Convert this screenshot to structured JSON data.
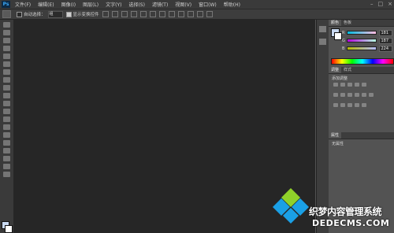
{
  "app": {
    "logo_text": "Ps"
  },
  "menu": {
    "items": [
      "文件(F)",
      "编辑(E)",
      "图像(I)",
      "图层(L)",
      "文字(Y)",
      "选择(S)",
      "滤镜(T)",
      "视图(V)",
      "窗口(W)",
      "帮助(H)"
    ]
  },
  "window_controls": {
    "minimize": "–",
    "maximize": "□",
    "close": "×"
  },
  "options_bar": {
    "auto_select_label": "自动选择：",
    "auto_select_value": "组",
    "show_transform_label": "显示变换控件"
  },
  "color_panel": {
    "tabs": [
      "颜色",
      "色板"
    ],
    "channels": [
      {
        "label": "R",
        "value": "181"
      },
      {
        "label": "G",
        "value": "187"
      },
      {
        "label": "B",
        "value": "224"
      }
    ],
    "foreground_color": "#c8d8f0",
    "background_color": "#ffffff"
  },
  "adjustments_panel": {
    "tabs": [
      "调整",
      "样式"
    ],
    "subtitle": "添加调整"
  },
  "properties_panel": {
    "tabs": [
      "属性"
    ],
    "status_text": "无属性"
  },
  "watermark": {
    "brand_cn": "织梦内容管理系统",
    "brand_url": "DEDECMS.COM"
  }
}
